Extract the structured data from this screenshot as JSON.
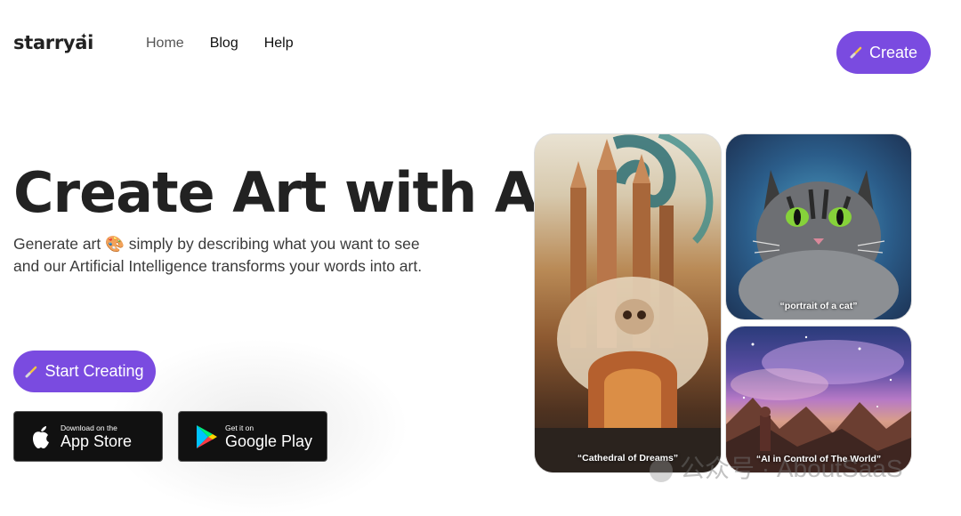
{
  "brand": {
    "name": "starryai"
  },
  "nav": {
    "items": [
      {
        "label": "Home"
      },
      {
        "label": "Blog"
      },
      {
        "label": "Help"
      }
    ]
  },
  "header": {
    "create_label": "Create"
  },
  "hero": {
    "title": "Create Art with AI",
    "subtitle_line1": "Generate art 🎨 simply by describing what you want to see",
    "subtitle_line2": "and our Artificial Intelligence transforms your words into art.",
    "start_label": "Start Creating"
  },
  "stores": {
    "apple": {
      "small": "Download on the",
      "big": "App Store"
    },
    "google": {
      "small": "Get it on",
      "big": "Google Play"
    }
  },
  "gallery": [
    {
      "caption": "“Cathedral of Dreams”"
    },
    {
      "caption": "“portrait of a cat”"
    },
    {
      "caption": "“AI in Control of The World”"
    }
  ],
  "watermark": "公众号 · AboutSaaS",
  "colors": {
    "accent": "#7a4be0",
    "text": "#232323"
  }
}
